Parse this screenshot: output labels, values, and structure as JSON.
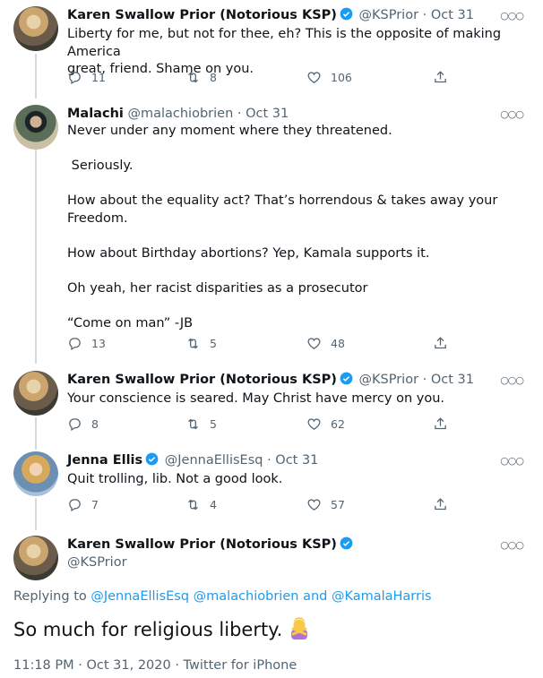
{
  "tweets": [
    {
      "name": "Karen Swallow Prior (Notorious KSP)",
      "handle": "@KSPrior",
      "dot": "·",
      "date": "Oct 31",
      "lines": [
        "Liberty for me, but not for thee, eh? This is the opposite of making America",
        "great, friend. Shame on you."
      ],
      "replies": "11",
      "retweets": "8",
      "likes": "106"
    },
    {
      "name": "Malachi",
      "handle": "@malachiobrien",
      "dot": "·",
      "date": "Oct 31",
      "lines": [
        "Never under any moment where they threatened.",
        "",
        " Seriously.",
        "",
        "How about the equality act? That’s horrendous & takes away your",
        "Freedom.",
        "",
        "How about Birthday abortions? Yep, Kamala supports it.",
        "",
        "Oh yeah, her racist disparities as a prosecutor",
        "",
        "“Come on man” -JB"
      ],
      "replies": "13",
      "retweets": "5",
      "likes": "48"
    },
    {
      "name": "Karen Swallow Prior (Notorious KSP)",
      "handle": "@KSPrior",
      "dot": "·",
      "date": "Oct 31",
      "lines": [
        "Your conscience is seared. May Christ have mercy on you."
      ],
      "replies": "8",
      "retweets": "5",
      "likes": "62"
    },
    {
      "name": "Jenna Ellis",
      "handle": "@JennaEllisEsq",
      "dot": "·",
      "date": "Oct 31",
      "lines": [
        "Quit trolling, lib. Not a good look."
      ],
      "replies": "7",
      "retweets": "4",
      "likes": "57"
    }
  ],
  "focus": {
    "name": "Karen Swallow Prior (Notorious KSP)",
    "handle": "@KSPrior",
    "replying_prefix": "Replying to",
    "replying_to": [
      "@JennaEllisEsq",
      "@malachiobrien",
      "@KamalaHarris"
    ],
    "and_word": "and",
    "text": "So much for religious liberty.",
    "emoji": "person-gesturing-no-emoji",
    "timestamp": "11:18 PM · Oct 31, 2020 · Twitter for iPhone"
  },
  "colors": {
    "accent": "#1d9bf0",
    "muted": "#536471",
    "text": "#0f1419",
    "thread": "#cfd9de"
  },
  "icons": [
    "reply-icon",
    "retweet-icon",
    "like-icon",
    "share-icon",
    "verified-badge-icon",
    "more-icon"
  ]
}
